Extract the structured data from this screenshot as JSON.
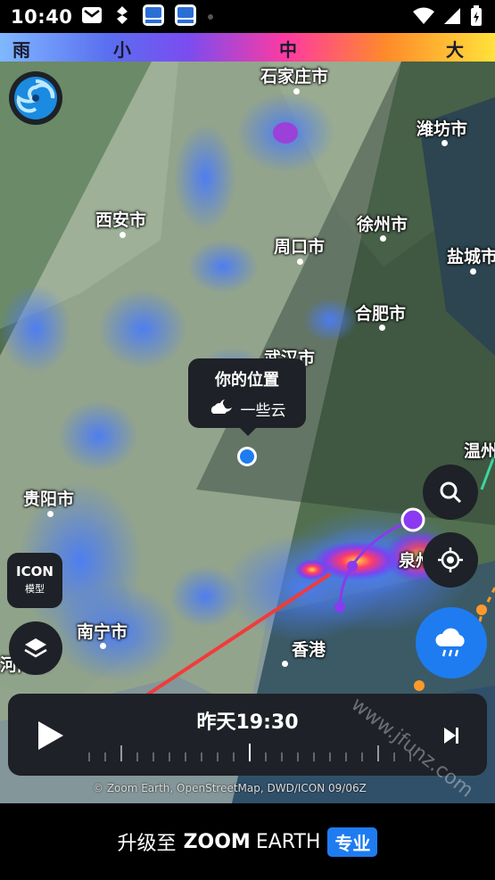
{
  "status_bar": {
    "time": "10:40"
  },
  "legend": {
    "labels": [
      "雨",
      "小",
      "中",
      "大"
    ]
  },
  "map": {
    "cities": [
      "石家庄市",
      "潍坊市",
      "西安市",
      "徐州市",
      "周口市",
      "盐城市",
      "合肥市",
      "武汉市",
      "温州",
      "贵阳市",
      "泉州",
      "南宁市",
      "香港",
      "河内市"
    ]
  },
  "location_tooltip": {
    "title": "你的位置",
    "condition": "一些云"
  },
  "model_button": {
    "name": "ICON",
    "subtitle": "模型"
  },
  "timeline": {
    "time": "昨天19:30"
  },
  "credit": "© Zoom Earth, OpenStreetMap, DWD/ICON 09/06Z",
  "banner": {
    "prefix": "升级至",
    "brand_bold": "ZOOM",
    "brand_light": "EARTH",
    "badge": "专业"
  },
  "watermark": "www.jfunz.com",
  "colors": {
    "accent": "#1e7cf0",
    "button_bg": "#1e2127"
  }
}
